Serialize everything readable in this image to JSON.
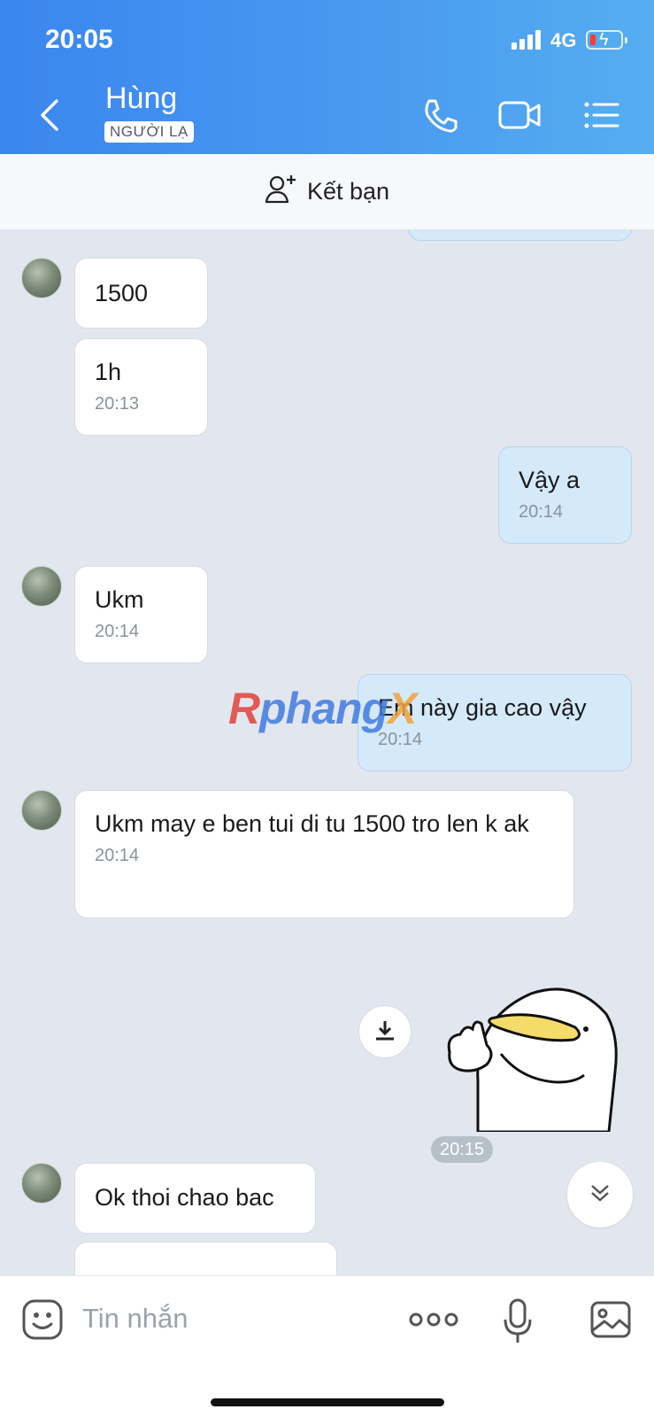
{
  "status_bar": {
    "time": "20:05",
    "network": "4G"
  },
  "header": {
    "contact_name": "Hùng",
    "badge": "NGƯỜI LẠ",
    "icons": [
      "back-chevron-icon",
      "phone-icon",
      "video-camera-icon",
      "menu-list-icon"
    ]
  },
  "add_friend": {
    "label": "Kết bạn",
    "icon": "add-user-icon"
  },
  "messages": [
    {
      "dir": "in",
      "text": "1500",
      "time": ""
    },
    {
      "dir": "in",
      "text": "1h",
      "time": "20:13"
    },
    {
      "dir": "out",
      "text": "Vậy a",
      "time": "20:14"
    },
    {
      "dir": "in",
      "text": "Ukm",
      "time": "20:14"
    },
    {
      "dir": "out",
      "text": "Em này gia cao vậy",
      "time": "20:14"
    },
    {
      "dir": "in",
      "text": "Ukm may e ben tui di tu 1500 tro len k ak",
      "time": "20:14"
    },
    {
      "dir": "in",
      "text": "Ok thoi chao bac",
      "time": ""
    }
  ],
  "sticker_time": "20:15",
  "watermark": {
    "part1": "R",
    "part2": "phang",
    "part3": "X"
  },
  "composer": {
    "placeholder": "Tin nhắn"
  },
  "colors": {
    "header_start": "#3a86ef",
    "header_end": "#56aef0",
    "outgoing_bubble": "#d4e9fa",
    "incoming_bubble": "#ffffff",
    "chat_bg": "#e2e7ef"
  }
}
